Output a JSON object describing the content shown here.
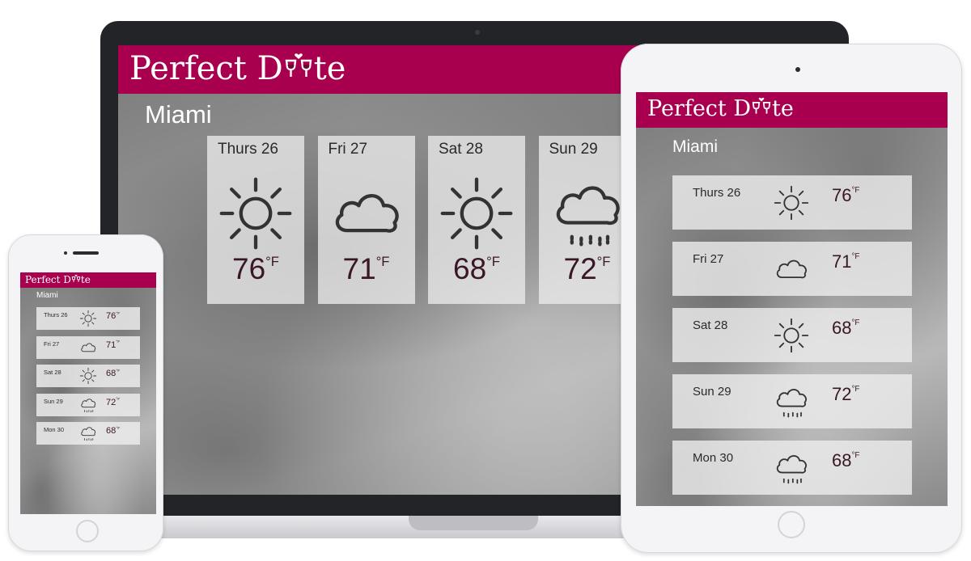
{
  "app": {
    "brand_prefix": "Perfect D",
    "brand_suffix": "te",
    "brand_color": "#a8004f"
  },
  "city": "Miami",
  "unit": "°F",
  "laptop": {
    "days": [
      {
        "day": "Thurs 26",
        "temp": "76",
        "icon": "sun-icon"
      },
      {
        "day": "Fri 27",
        "temp": "71",
        "icon": "cloud-icon"
      },
      {
        "day": "Sat 28",
        "temp": "68",
        "icon": "sun-icon"
      },
      {
        "day": "Sun 29",
        "temp": "72",
        "icon": "rain-cloud-icon"
      }
    ]
  },
  "tablet": {
    "days": [
      {
        "day": "Thurs 26",
        "temp": "76",
        "icon": "sun-icon"
      },
      {
        "day": "Fri 27",
        "temp": "71",
        "icon": "cloud-icon"
      },
      {
        "day": "Sat 28",
        "temp": "68",
        "icon": "sun-icon"
      },
      {
        "day": "Sun 29",
        "temp": "72",
        "icon": "rain-cloud-icon"
      },
      {
        "day": "Mon 30",
        "temp": "68",
        "icon": "rain-cloud-icon"
      }
    ]
  },
  "phone": {
    "days": [
      {
        "day": "Thurs 26",
        "temp": "76",
        "icon": "sun-icon"
      },
      {
        "day": "Fri 27",
        "temp": "71",
        "icon": "cloud-icon"
      },
      {
        "day": "Sat 28",
        "temp": "68",
        "icon": "sun-icon"
      },
      {
        "day": "Sun 29",
        "temp": "72",
        "icon": "rain-cloud-icon"
      },
      {
        "day": "Mon 30",
        "temp": "68",
        "icon": "rain-cloud-icon"
      }
    ]
  }
}
